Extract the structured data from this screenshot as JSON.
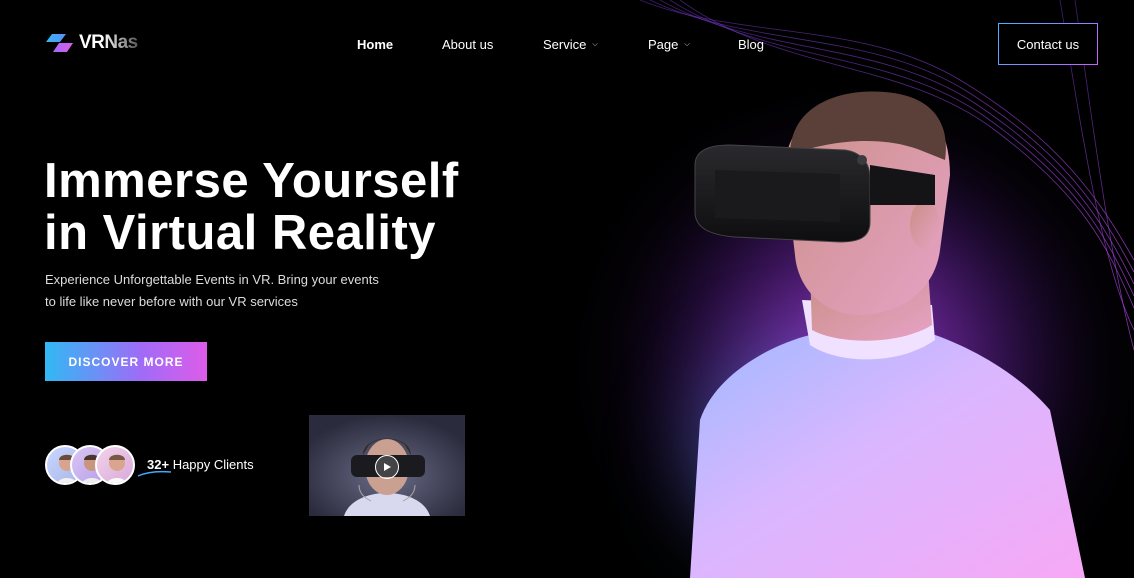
{
  "brand": {
    "name": "VRNas"
  },
  "nav": {
    "items": [
      {
        "label": "Home",
        "active": true,
        "has_dropdown": false
      },
      {
        "label": "About us",
        "active": false,
        "has_dropdown": false
      },
      {
        "label": "Service",
        "active": false,
        "has_dropdown": true
      },
      {
        "label": "Page",
        "active": false,
        "has_dropdown": true
      },
      {
        "label": "Blog",
        "active": false,
        "has_dropdown": false
      }
    ],
    "contact_label": "Contact us"
  },
  "hero": {
    "title_line1": "Immerse Yourself",
    "title_line2": "in Virtual Reality",
    "subtitle_line1": "Experience Unforgettable Events in VR. Bring your events",
    "subtitle_line2": "to life like never before with our VR services",
    "cta_label": "DISCOVER MORE"
  },
  "clients": {
    "count": "32+",
    "label": "Happy Clients"
  },
  "video": {
    "icon": "play-icon"
  },
  "colors": {
    "accent_blue": "#31b9f4",
    "accent_purple": "#a06bf7",
    "accent_pink": "#dd5ce9",
    "background": "#000000"
  }
}
